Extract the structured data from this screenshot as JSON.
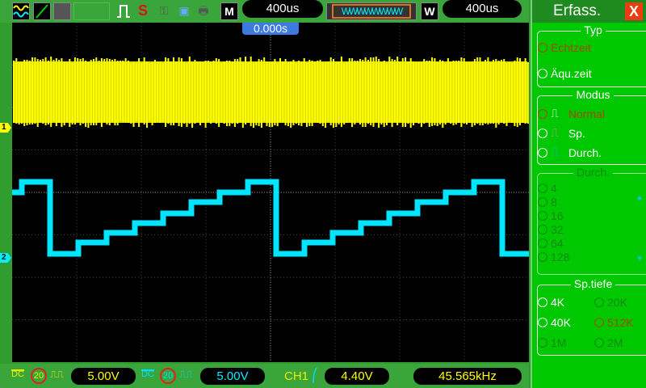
{
  "toolbar": {
    "icons": [
      "dual-wave-icon",
      "line-icon",
      "image-icon",
      "blank-box",
      "acquire-normal-icon",
      "s-icon",
      "key-icon",
      "save-icon",
      "print-icon"
    ],
    "s_label": "S",
    "m_label": "M",
    "timebase": "400us",
    "w_label": "W",
    "window_timebase": "400us",
    "trigger_position": "0.000s"
  },
  "panel": {
    "title": "Erfass.",
    "close": "X",
    "typ": {
      "label": "Typ",
      "options": [
        "Echtzeit",
        "Äqu.zeit"
      ],
      "selected": "Echtzeit"
    },
    "modus": {
      "label": "Modus",
      "options": [
        "Normal",
        "Sp.",
        "Durch."
      ],
      "selected": "Normal"
    },
    "durch": {
      "label": "Durch.",
      "options": [
        "4",
        "8",
        "16",
        "32",
        "64",
        "128"
      ],
      "selected": "4"
    },
    "sptiefe": {
      "label": "Sp.tiefe",
      "options": [
        "4K",
        "20K",
        "40K",
        "512K",
        "1M",
        "2M"
      ],
      "selected": "512K"
    }
  },
  "channels": {
    "ch1_marker": "1",
    "ch2_marker": "2",
    "ch1_coupling": "DC",
    "ch1_bw": "20",
    "ch1_scale": "5.00V",
    "ch2_coupling": "DC",
    "ch2_bw": "20",
    "ch2_scale": "5.00V"
  },
  "trigger": {
    "source": "CH1",
    "level": "4.40V",
    "frequency": "45.565kHz"
  },
  "colors": {
    "ch1": "#ffff00",
    "ch2": "#00e5ff",
    "panel": "#00c800"
  }
}
